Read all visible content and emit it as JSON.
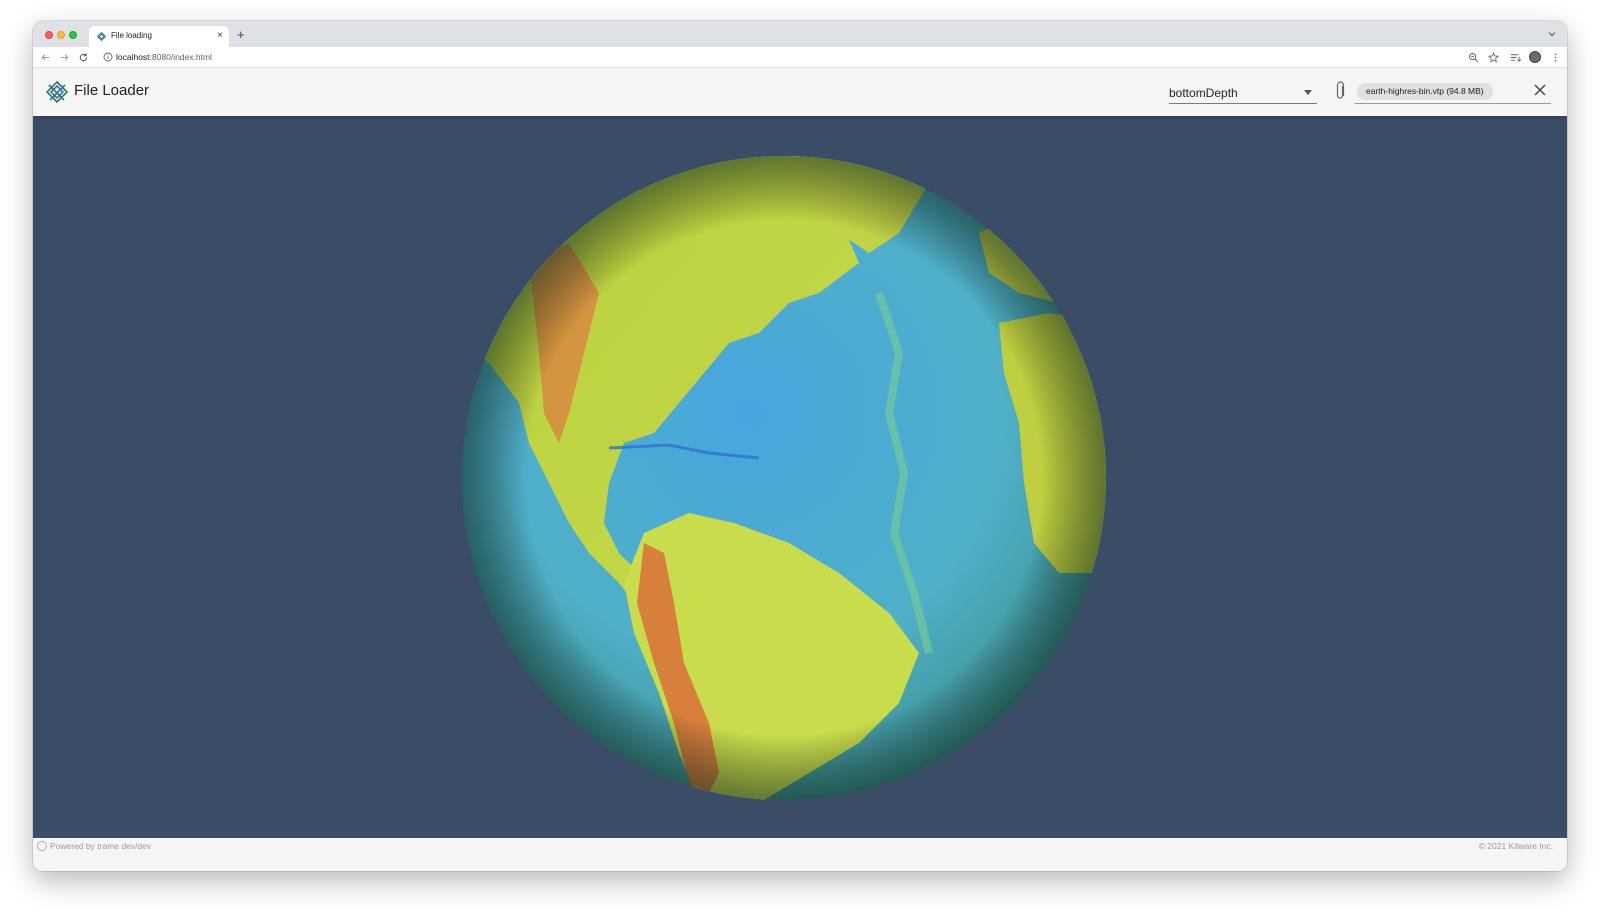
{
  "browser": {
    "tab_title": "File loading",
    "tab_close": "×",
    "new_tab": "+",
    "url_host": "localhost",
    "url_path": ":8080/index.html"
  },
  "app": {
    "title": "File Loader",
    "field_select": {
      "value": "bottomDepth"
    },
    "file": {
      "chip_label": "earth-highres-bin.vtp (94.8 MB)"
    }
  },
  "footer": {
    "powered_by": "Powered by trame dev/dev",
    "copyright": "© 2021 Kitware Inc."
  },
  "icons": {
    "app_logo": "kitware-trame-logo-icon",
    "attach": "paperclip-icon",
    "clear": "close-icon",
    "select_caret": "caret-down-icon"
  },
  "colors": {
    "viewport_background": "#3b4d66",
    "land": "#c7d64a",
    "ocean": "#4fa8d6",
    "mountains": "#d97b3a"
  }
}
